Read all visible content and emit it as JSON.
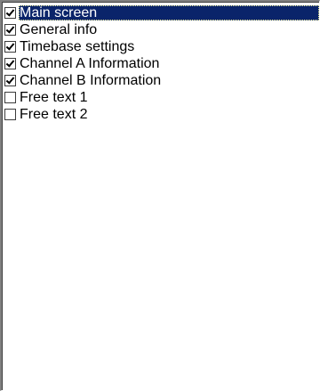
{
  "list": {
    "items": [
      {
        "label": "Main screen",
        "checked": true,
        "selected": true
      },
      {
        "label": "General info",
        "checked": true,
        "selected": false
      },
      {
        "label": "Timebase settings",
        "checked": true,
        "selected": false
      },
      {
        "label": "Channel A Information",
        "checked": true,
        "selected": false
      },
      {
        "label": "Channel B Information",
        "checked": true,
        "selected": false
      },
      {
        "label": "Free text 1",
        "checked": false,
        "selected": false
      },
      {
        "label": "Free text 2",
        "checked": false,
        "selected": false
      }
    ]
  },
  "colors": {
    "selection_background": "#0a246a",
    "selection_text": "#ffffff",
    "list_background": "#ffffff"
  }
}
